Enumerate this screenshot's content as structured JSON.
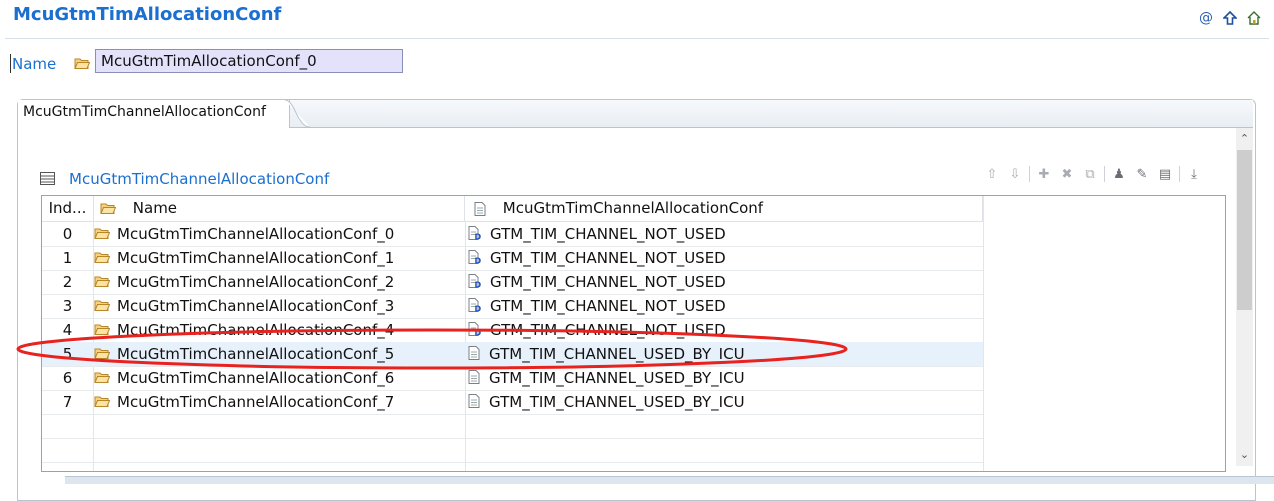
{
  "page": {
    "title": "McuGtmTimAllocationConf"
  },
  "top_icons": [
    "at-icon",
    "up-arrow-icon",
    "home-icon"
  ],
  "name_field": {
    "label": "Name",
    "value": "McuGtmTimAllocationConf_0"
  },
  "tab": {
    "label": "McuGtmTimChannelAllocationConf"
  },
  "section": {
    "title": "McuGtmTimChannelAllocationConf"
  },
  "table": {
    "headers": {
      "index": "Ind...",
      "name": "Name",
      "value": "McuGtmTimChannelAllocationConf"
    },
    "rows": [
      {
        "index": "0",
        "name": "McuGtmTimChannelAllocationConf_0",
        "value": "GTM_TIM_CHANNEL_NOT_USED",
        "is_default": true
      },
      {
        "index": "1",
        "name": "McuGtmTimChannelAllocationConf_1",
        "value": "GTM_TIM_CHANNEL_NOT_USED",
        "is_default": true
      },
      {
        "index": "2",
        "name": "McuGtmTimChannelAllocationConf_2",
        "value": "GTM_TIM_CHANNEL_NOT_USED",
        "is_default": true
      },
      {
        "index": "3",
        "name": "McuGtmTimChannelAllocationConf_3",
        "value": "GTM_TIM_CHANNEL_NOT_USED",
        "is_default": true
      },
      {
        "index": "4",
        "name": "McuGtmTimChannelAllocationConf_4",
        "value": "GTM_TIM_CHANNEL_NOT_USED",
        "is_default": true
      },
      {
        "index": "5",
        "name": "McuGtmTimChannelAllocationConf_5",
        "value": "GTM_TIM_CHANNEL_USED_BY_ICU",
        "is_default": false,
        "selected": true
      },
      {
        "index": "6",
        "name": "McuGtmTimChannelAllocationConf_6",
        "value": "GTM_TIM_CHANNEL_USED_BY_ICU",
        "is_default": false
      },
      {
        "index": "7",
        "name": "McuGtmTimChannelAllocationConf_7",
        "value": "GTM_TIM_CHANNEL_USED_BY_ICU",
        "is_default": false
      }
    ]
  },
  "annotation": {
    "color": "#e8231f"
  }
}
